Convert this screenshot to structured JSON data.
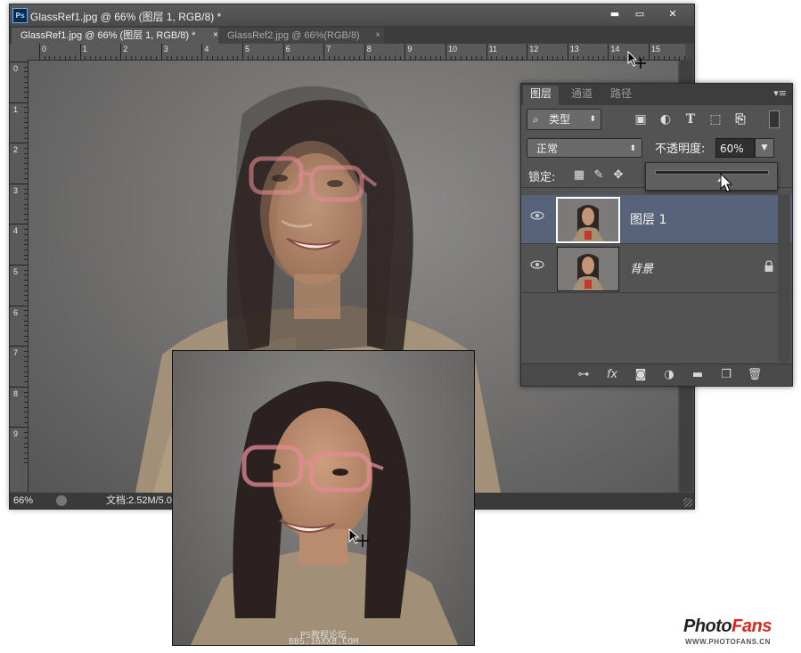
{
  "window": {
    "app_icon": "Ps",
    "title": "GlassRef1.jpg @ 66% (图层 1, RGB/8) *",
    "minimize": "▬",
    "maximize": "▭",
    "close": "✕"
  },
  "tabs": [
    {
      "label": "GlassRef1.jpg @ 66% (图层 1, RGB/8) *",
      "close": "×"
    },
    {
      "label": "GlassRef2.jpg @ 66%(RGB/8)",
      "close": "×"
    }
  ],
  "rulers": {
    "top_labels": [
      "0",
      "1",
      "2",
      "3",
      "4",
      "5",
      "6",
      "7",
      "8",
      "9",
      "10",
      "11",
      "12",
      "13",
      "14",
      "15"
    ],
    "left_labels": [
      "0",
      "1",
      "2",
      "3",
      "4",
      "5",
      "6",
      "7",
      "8",
      "9"
    ]
  },
  "status": {
    "zoom": "66%",
    "doc_info": "文档:2.52M/5.0"
  },
  "layers_panel": {
    "tabs": [
      "图层",
      "通道",
      "路径"
    ],
    "menu_icon": "▾≡",
    "filter_kind": "类型",
    "filter_kind_icon": "search-icon",
    "filter_icons": [
      "image-icon",
      "adjustment-icon",
      "text-icon",
      "shape-icon",
      "smart-object-icon"
    ],
    "blend_mode": "正常",
    "opacity_label": "不透明度:",
    "opacity_value": "60%",
    "opacity_fraction": 0.6,
    "lock_label": "锁定:",
    "layers": [
      {
        "name": "图层 1",
        "selected": true,
        "visible": true
      },
      {
        "name": "背景",
        "selected": false,
        "visible": true,
        "locked": true
      }
    ],
    "footer_icons": [
      "link-icon",
      "fx-icon",
      "mask-icon",
      "adjustment-layer-icon",
      "folder-icon",
      "new-layer-icon",
      "trash-icon"
    ]
  },
  "inset": {
    "watermark_line1": "PS教程论坛",
    "watermark_line2": "BBS.16XX8.COM"
  },
  "brand": {
    "photo": "Photo",
    "fans": "Fans",
    "url": "WWW.PHOTOFANS.CN"
  },
  "colors": {
    "selected_layer": "#566378",
    "brand_red": "#d8281f",
    "glasses": "#e48a96"
  }
}
